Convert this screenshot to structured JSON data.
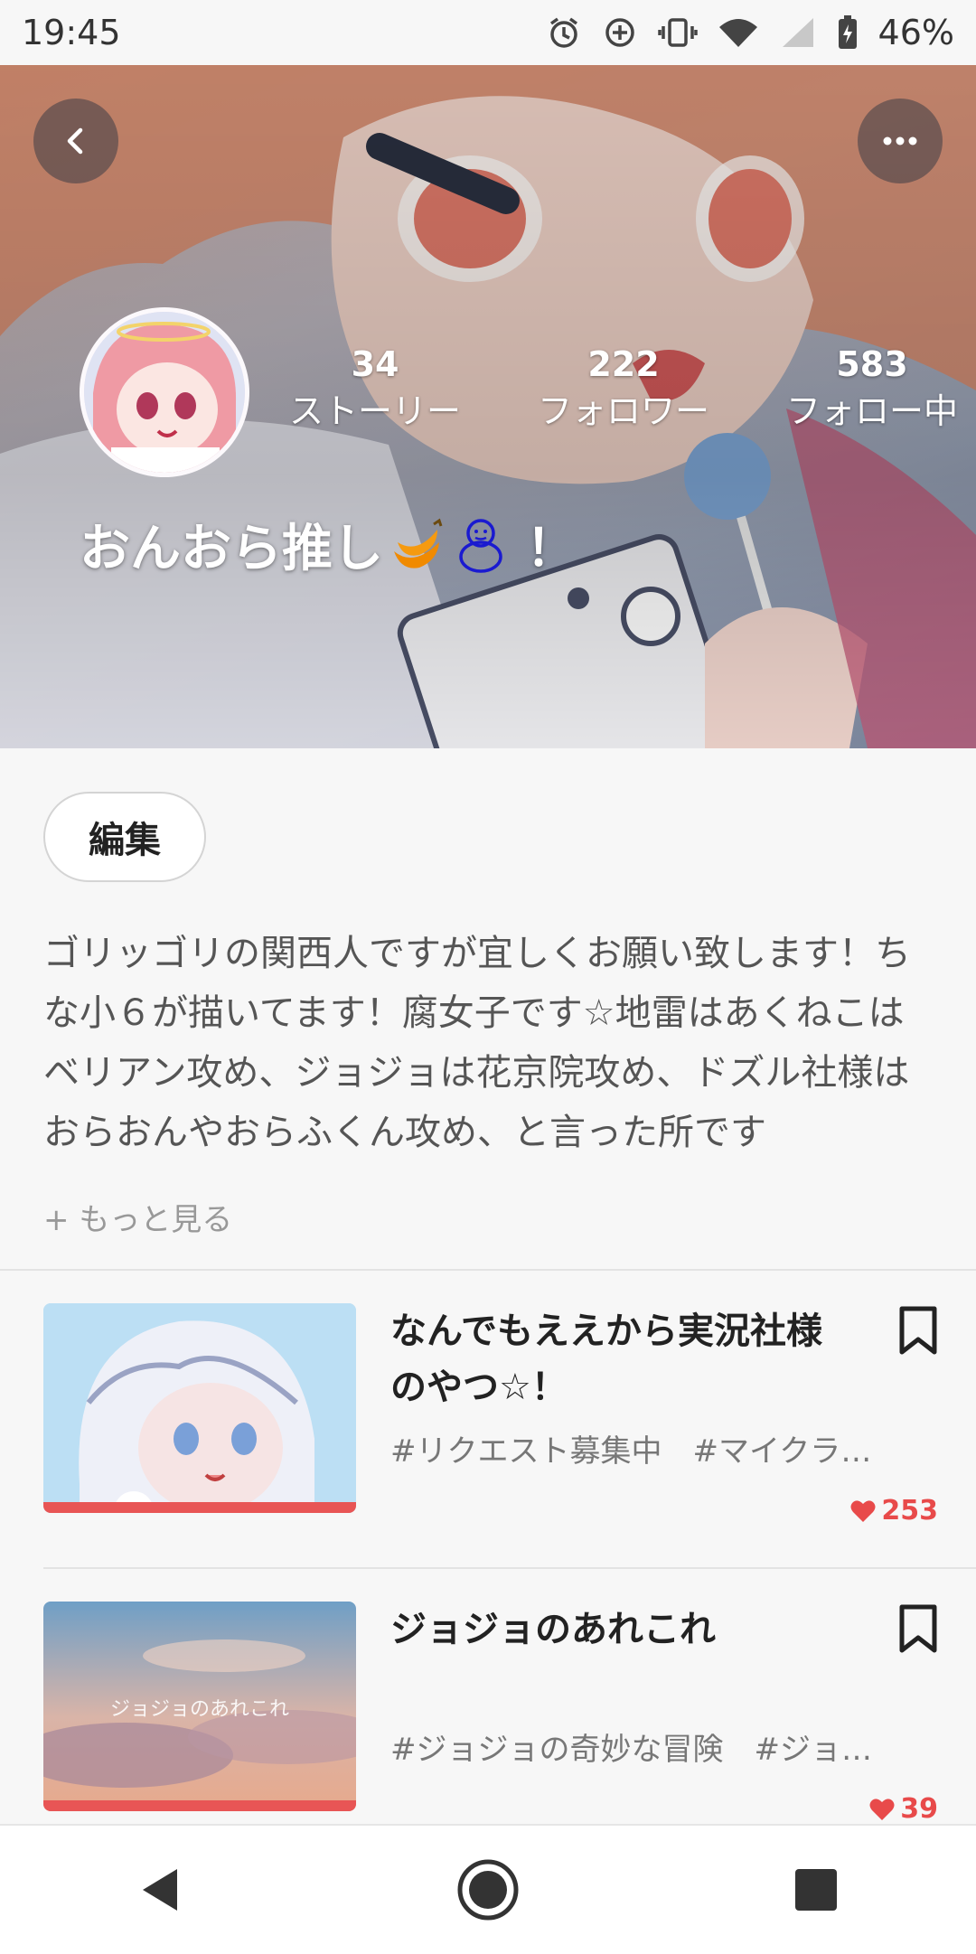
{
  "status_bar": {
    "time": "19:45",
    "battery": "46%",
    "icons": [
      "alarm-icon",
      "data-saver-icon",
      "vibrate-icon",
      "wifi-icon",
      "signal-icon",
      "battery-charging-icon"
    ]
  },
  "header": {
    "back_icon": "chevron-left-icon",
    "more_icon": "more-horizontal-icon",
    "stats": [
      {
        "value": "34",
        "label": "ストーリー"
      },
      {
        "value": "222",
        "label": "フォロワー"
      },
      {
        "value": "583",
        "label": "フォロー中"
      }
    ],
    "name_prefix": "おんおら推し",
    "name_suffix": "！",
    "name_emojis": [
      "banana-icon",
      "snowman-outline-icon"
    ]
  },
  "profile": {
    "edit_label": "編集",
    "bio": "ゴリッゴリの関西人ですが宜しくお願い致します！ちな小６が描いてます！腐女子です☆地雷はあくねこはベリアン攻め、ジョジョは花京院攻め、ドズル社様はおらおんやおらふくん攻め、と言った所です",
    "more_label": "+ もっと見る"
  },
  "stories": [
    {
      "title": "なんでもええから実況社様のやつ☆！",
      "tags": [
        "#リクエスト募集中",
        "#マイクラ実況"
      ],
      "likes": "253",
      "thumb_text": ""
    },
    {
      "title": "ジョジョのあれこれ",
      "tags": [
        "#ジョジョの奇妙な冒険",
        "#ジョジョ"
      ],
      "likes": "39",
      "thumb_text": "ジョジョのあれこれ"
    }
  ],
  "colors": {
    "accent": "#e84a4a",
    "progress_bar": "#e85555",
    "text_primary": "#222222",
    "text_secondary": "#777777"
  },
  "navbar": {
    "icons": [
      "back-triangle-icon",
      "home-circle-icon",
      "recents-square-icon"
    ]
  }
}
